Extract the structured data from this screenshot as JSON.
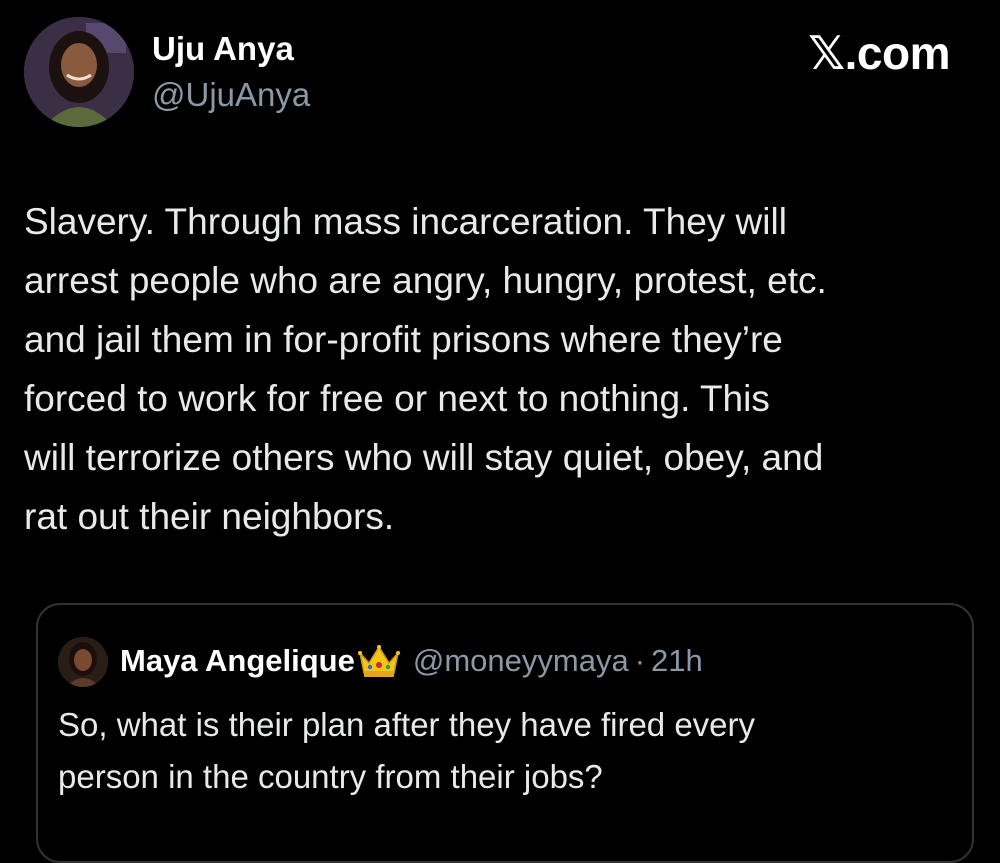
{
  "author": {
    "display_name": "Uju Anya",
    "handle": "@UjuAnya",
    "avatar_icon": "profile-photo"
  },
  "brand": {
    "x_mark": "𝕏",
    "suffix": ".com"
  },
  "tweet": {
    "lines": [
      "Slavery. Through mass incarceration. They will",
      "arrest people who are angry, hungry, protest, etc.",
      "and jail them in for-profit prisons where they’re",
      "forced to work for free or next to nothing. This",
      "will terrorize others who will stay quiet, obey, and",
      "rat out their neighbors."
    ]
  },
  "quoted": {
    "display_name": "Maya Angelique",
    "emoji_icon": "crown-icon",
    "handle": "@moneyymaya",
    "separator": "·",
    "time": "21h",
    "lines": [
      "So, what is their plan after they have fired every",
      "person in the country from their jobs?"
    ]
  },
  "colors": {
    "background": "#000000",
    "primary_text": "#e7e9ea",
    "secondary_text": "#8b98a5",
    "border": "#2f3336"
  }
}
